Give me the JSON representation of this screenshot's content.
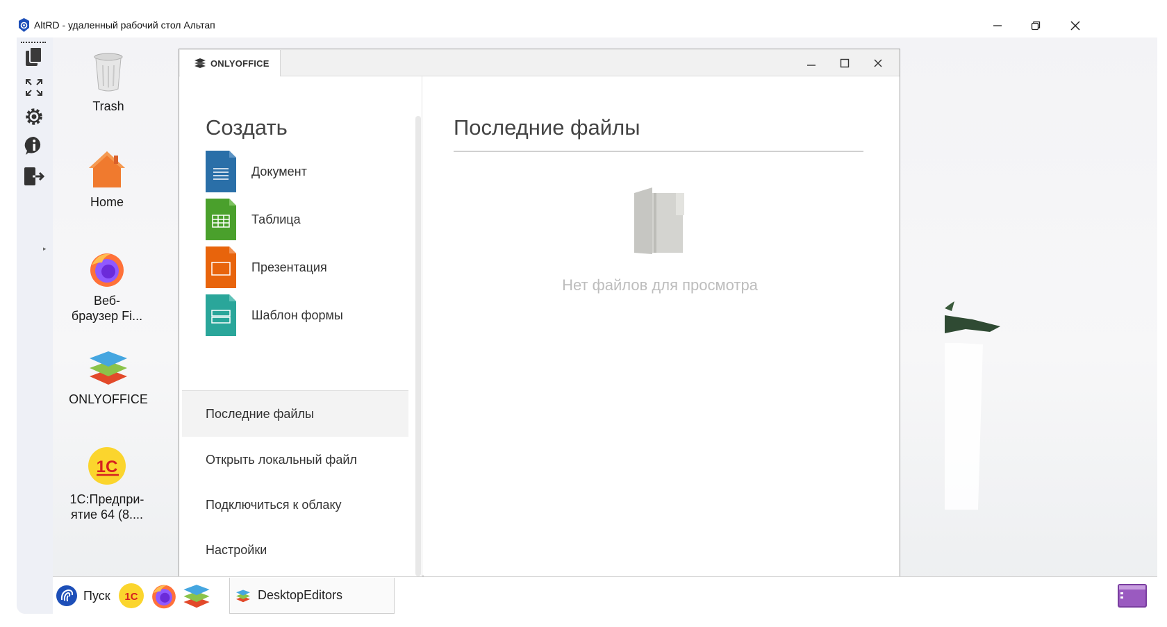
{
  "altrd": {
    "window_title": "AltRD - удаленный рабочий стол Альтап",
    "controls": [
      "minimize-icon",
      "restore-icon",
      "close-icon"
    ],
    "sidebar_icons": [
      "copy-icon",
      "fullscreen-icon",
      "settings-icon",
      "info-icon",
      "exit-icon"
    ]
  },
  "desktop": {
    "icons": [
      {
        "label": "Trash",
        "icon": "trash-icon"
      },
      {
        "label": "Home",
        "icon": "home-icon"
      },
      {
        "label": "Веб-\nбраузер Fi...",
        "line1": "Веб-",
        "line2": "браузер Fi...",
        "icon": "firefox-icon"
      },
      {
        "label": "ONLYOFFICE",
        "icon": "onlyoffice-icon"
      },
      {
        "line1": "1С:Предпри-",
        "line2": "ятие 64 (8....",
        "icon": "1c-icon"
      }
    ]
  },
  "onlyoffice": {
    "tab_label": "ONLYOFFICE",
    "create_title": "Создать",
    "create_items": [
      {
        "label": "Документ",
        "color": "#2a6fa8"
      },
      {
        "label": "Таблица",
        "color": "#4aa02c"
      },
      {
        "label": "Презентация",
        "color": "#e8640c"
      },
      {
        "label": "Шаблон формы",
        "color": "#2aa69a"
      }
    ],
    "menu": [
      {
        "label": "Последние файлы",
        "active": true
      },
      {
        "label": "Открыть локальный файл",
        "active": false
      },
      {
        "label": "Подключиться к облаку",
        "active": false
      },
      {
        "label": "Настройки",
        "active": false
      }
    ],
    "recent_title": "Последние файлы",
    "empty_text": "Нет файлов для просмотра"
  },
  "taskbar": {
    "start_label": "Пуск",
    "quick_launch": [
      "1c-icon",
      "firefox-icon",
      "onlyoffice-icon"
    ],
    "task_label": "DesktopEditors"
  }
}
